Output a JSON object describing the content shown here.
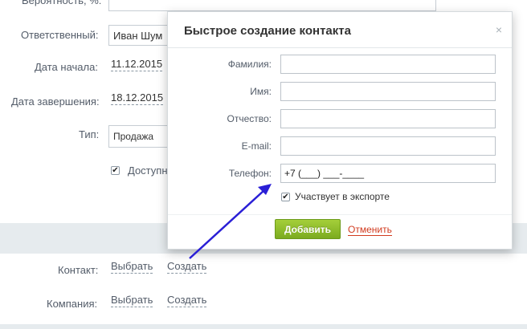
{
  "form": {
    "probability_label": "Вероятность, %:",
    "responsible_label": "Ответственный:",
    "responsible_value": "Иван Шум",
    "start_label": "Дата начала:",
    "start_value": "11.12.2015",
    "end_label": "Дата завершения:",
    "end_value": "18.12.2015",
    "type_label": "Тип:",
    "type_value": "Продажа",
    "available_label": "Доступн",
    "contact_label": "Контакт:",
    "contact_select": "Выбрать",
    "contact_create": "Создать",
    "company_label": "Компания:",
    "company_select": "Выбрать",
    "company_create": "Создать"
  },
  "dialog": {
    "title": "Быстрое создание контакта",
    "close": "×",
    "fields": {
      "lastname_label": "Фамилия:",
      "firstname_label": "Имя:",
      "middlename_label": "Отчество:",
      "email_label": "E-mail:",
      "phone_label": "Телефон:",
      "phone_value": "+7 (___) ___-____"
    },
    "export_label": "Участвует в экспорте",
    "export_checked": true,
    "add_button": "Добавить",
    "cancel_link": "Отменить"
  },
  "colors": {
    "accent_green": "#8bbd2a",
    "cancel_red": "#d13b1f",
    "arrow": "#2a1fd6"
  }
}
